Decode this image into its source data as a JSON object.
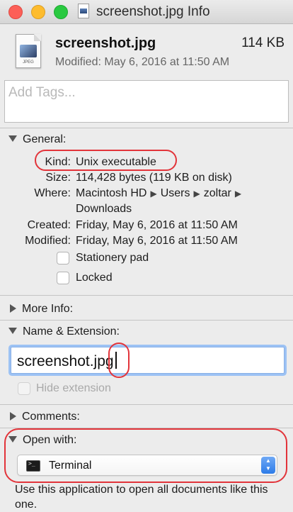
{
  "window": {
    "title": "screenshot.jpg  Info"
  },
  "header": {
    "file_name": "screenshot.jpg",
    "file_size": "114 KB",
    "modified": "Modified: May 6, 2016 at 11:50 AM",
    "icon_label": "JPEG"
  },
  "tags": {
    "placeholder": "Add Tags..."
  },
  "general": {
    "title": "General:",
    "rows": [
      {
        "key": "Kind:",
        "value": "Unix executable"
      },
      {
        "key": "Size:",
        "value": "114,428 bytes (119 KB on disk)"
      },
      {
        "key": "Where:",
        "value": "Macintosh HD ▸ Users ▸ zoltar ▸",
        "value2": "Downloads"
      },
      {
        "key": "Created:",
        "value": "Friday, May 6, 2016 at 11:50 AM"
      },
      {
        "key": "Modified:",
        "value": "Friday, May 6, 2016 at 11:50 AM"
      }
    ],
    "where_parts": [
      "Macintosh HD",
      "Users",
      "zoltar"
    ],
    "stationery_label": "Stationery pad",
    "locked_label": "Locked"
  },
  "more_info": {
    "title": "More Info:"
  },
  "name_extension": {
    "title": "Name & Extension:",
    "value": "screenshot.jpg",
    "hide_extension_label": "Hide extension"
  },
  "comments": {
    "title": "Comments:"
  },
  "open_with": {
    "title": "Open with:",
    "selected_app": "Terminal",
    "help_text": "Use this application to open all documents like this one."
  },
  "colors": {
    "annotation": "#e2343a",
    "focus_ring": "#9cc2f4",
    "stepper": "#2d7be8"
  }
}
